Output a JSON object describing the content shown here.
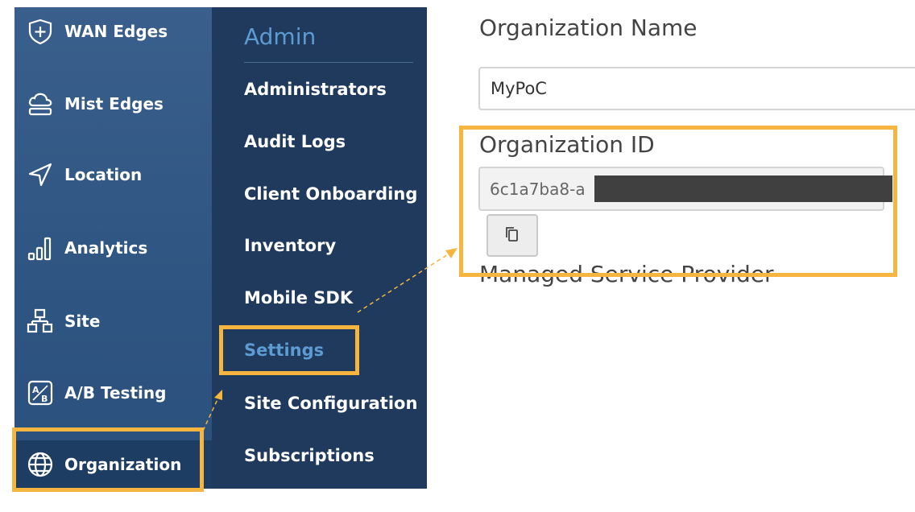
{
  "sidebar": {
    "items": [
      {
        "label": "WAN Edges",
        "icon": "wan-edges-icon"
      },
      {
        "label": "Mist Edges",
        "icon": "mist-edges-icon"
      },
      {
        "label": "Location",
        "icon": "location-icon"
      },
      {
        "label": "Analytics",
        "icon": "analytics-icon"
      },
      {
        "label": "Site",
        "icon": "site-icon"
      },
      {
        "label": "A/B Testing",
        "icon": "ab-testing-icon"
      },
      {
        "label": "Organization",
        "icon": "organization-icon",
        "selected": true
      }
    ]
  },
  "submenu": {
    "title": "Admin",
    "items": [
      {
        "label": "Administrators"
      },
      {
        "label": "Audit Logs"
      },
      {
        "label": "Client Onboarding"
      },
      {
        "label": "Inventory"
      },
      {
        "label": "Mobile SDK"
      },
      {
        "label": "Settings",
        "active": true
      },
      {
        "label": "Site Configuration"
      },
      {
        "label": "Subscriptions"
      }
    ]
  },
  "content": {
    "org_name_label": "Organization Name",
    "org_name_value": "MyPoC",
    "org_id_label": "Organization ID",
    "org_id_value": "6c1a7ba8-a",
    "copy_icon": "copy-icon",
    "msp_label": "Managed Service Provider"
  },
  "colors": {
    "sidebar_bg": "#3a5f8c",
    "submenu_bg": "#1f3a5c",
    "accent_blue": "#5d9bd3",
    "highlight": "#f5b53f"
  }
}
